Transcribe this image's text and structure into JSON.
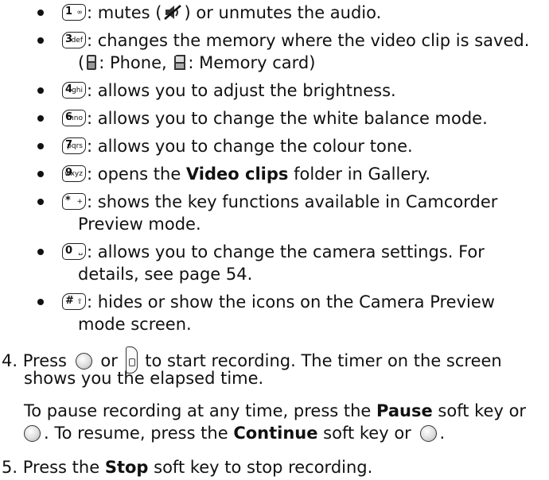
{
  "items": [
    {
      "key": "1",
      "sub": "∞",
      "text": ": mutes (",
      "text2": ") or unmutes the audio."
    },
    {
      "key": "3",
      "sub": "def",
      "text": ": changes the memory where the video clip is saved.",
      "sub_line": {
        "open": "(",
        "phone": ": Phone, ",
        "card": ": Memory card)"
      }
    },
    {
      "key": "4",
      "sub": "ghi",
      "text": ": allows you to adjust the brightness."
    },
    {
      "key": "6",
      "sub": "mno",
      "text": ": allows you to change the white balance mode."
    },
    {
      "key": "7",
      "sub": "pqrs",
      "text": ": allows you to change the colour tone."
    },
    {
      "key": "9",
      "sub": "wxyz",
      "text_pre": ": opens the ",
      "bold": "Video clips",
      "text_post": " folder in Gallery."
    },
    {
      "key": "*",
      "sub": "+",
      "line1": ": shows the key functions available in Camcorder",
      "line2": "Preview mode."
    },
    {
      "key": "0",
      "sub": "␣",
      "line1": ": allows you to change the camera settings. For",
      "line2": "details, see page 54."
    },
    {
      "key": "#",
      "sub": "⇧",
      "line1": ": hides or show the icons on the Camera Preview",
      "line2": "mode screen."
    }
  ],
  "step4": {
    "num": "4.",
    "a": "Press ",
    "b": " or ",
    "c": " to start recording. The timer on the screen",
    "line2": "shows you the elapsed time.",
    "p_a": "To pause recording at any time, press the ",
    "p_bold1": "Pause",
    "p_b": " soft key or",
    "p2_a": ". To resume, press the ",
    "p2_bold": "Continue",
    "p2_b": " soft key or ",
    "p2_c": "."
  },
  "step5": {
    "num": "5.",
    "a": "Press the ",
    "bold": "Stop",
    "b": " soft key to stop recording."
  },
  "icons": {
    "mute": "mute-icon",
    "phone": "phone-memory-icon",
    "card": "memory-card-icon",
    "ok": "center-ok-key-icon",
    "camera": "side-camera-key-icon"
  }
}
